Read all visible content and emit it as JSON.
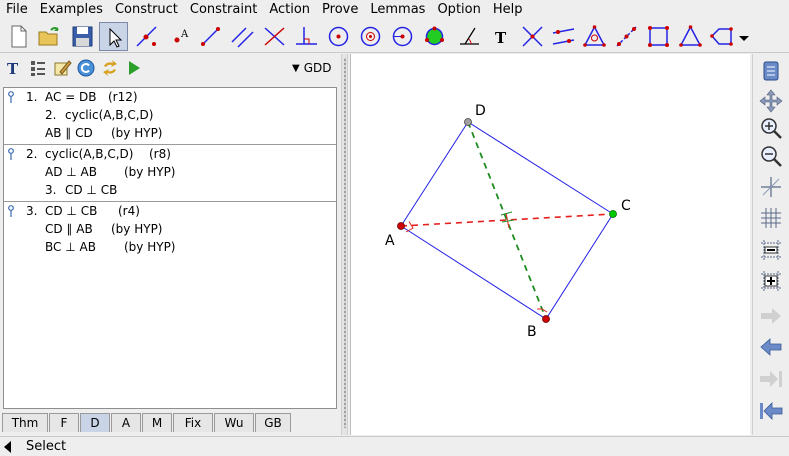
{
  "menu": [
    "File",
    "Examples",
    "Construct",
    "Constraint",
    "Action",
    "Prove",
    "Lemmas",
    "Option",
    "Help"
  ],
  "toolbar": {
    "text_tool_glyph": "T",
    "label_tool_glyph": "A",
    "icons": [
      "new-file-icon",
      "open-folder-icon",
      "save-icon",
      "select-arrow-icon",
      "point-on-line-icon",
      "point-label-icon",
      "line-icon",
      "parallel-line-icon",
      "perpendicular-line-icon",
      "foot-icon",
      "circle-icon",
      "circle-center-icon",
      "circle-three-point-icon",
      "circle-fill-icon",
      "angle-icon",
      "text-icon",
      "intersection-icon",
      "mirror-icon",
      "triangle-icon",
      "midpoint-icon",
      "square-icon",
      "isosceles-triangle-icon",
      "polygon-icon"
    ]
  },
  "left_panel": {
    "selector": "GDD",
    "proof": [
      {
        "lines": [
          {
            "num": "1.",
            "text": "AC = DB",
            "note": "(r12)"
          },
          {
            "num": "2.",
            "text": "cyclic(A,B,C,D)",
            "note": ""
          },
          {
            "num": "",
            "text": "AB ∥ CD",
            "note": "(by HYP)"
          }
        ]
      },
      {
        "lines": [
          {
            "num": "2.",
            "text": "cyclic(A,B,C,D)",
            "note": "(r8)"
          },
          {
            "num": "",
            "text": "AD ⊥ AB",
            "note": "(by HYP)"
          },
          {
            "num": "3.",
            "text": "CD ⊥ CB",
            "note": ""
          }
        ]
      },
      {
        "lines": [
          {
            "num": "3.",
            "text": "CD ⊥ CB",
            "note": "(r4)"
          },
          {
            "num": "",
            "text": "CD ∥ AB",
            "note": "(by HYP)"
          },
          {
            "num": "",
            "text": "BC ⊥ AB",
            "note": "(by HYP)"
          }
        ]
      }
    ],
    "tabs": [
      "Thm",
      "F",
      "D",
      "A",
      "M",
      "Fix",
      "Wu",
      "GB"
    ],
    "active_tab": "D"
  },
  "canvas": {
    "labels": {
      "A": "A",
      "B": "B",
      "C": "C",
      "D": "D"
    },
    "colors": {
      "line": "#2323e6",
      "dashed_red": "#e62020",
      "dashed_green": "#1e8c1e",
      "point_red": "#cc0000",
      "point_green": "#00cc00",
      "point_gray": "#a0a0a0"
    }
  },
  "status": {
    "text": "Select"
  }
}
